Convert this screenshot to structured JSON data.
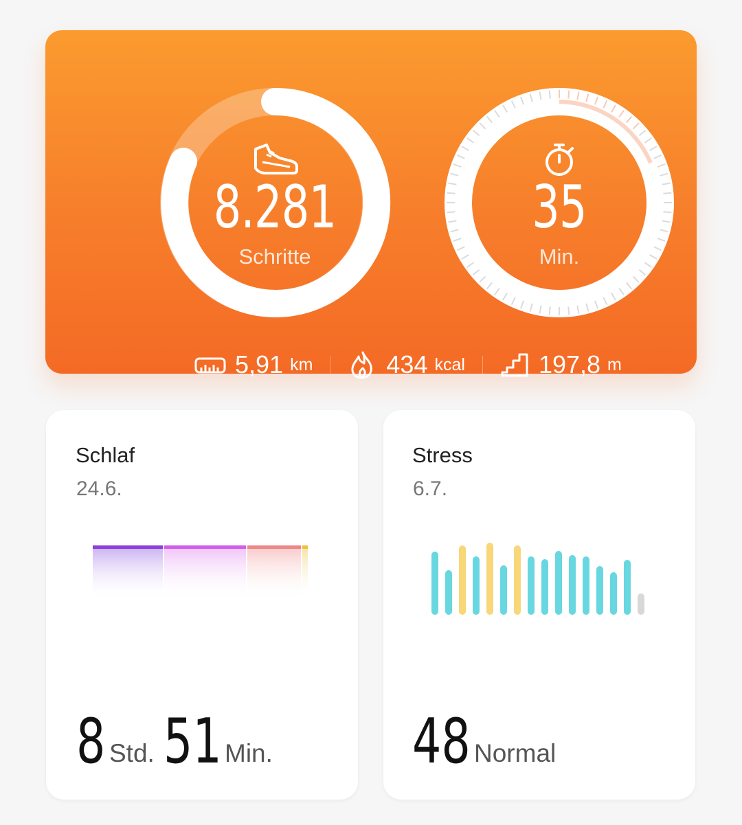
{
  "activity": {
    "steps": {
      "value": "8.281",
      "unit": "Schritte",
      "icon": "shoe-icon"
    },
    "active_minutes": {
      "value": "35",
      "unit": "Min.",
      "icon": "stopwatch-icon"
    },
    "distance": {
      "value": "5,91",
      "unit": "km",
      "icon": "ruler-icon"
    },
    "calories": {
      "value": "434",
      "unit": "kcal",
      "icon": "flame-icon"
    },
    "climb": {
      "value": "197,8",
      "unit": "m",
      "icon": "stairs-icon"
    },
    "colors": {
      "gradient_top": "#fb9b2e",
      "gradient_bottom": "#f46a25",
      "ring": "#ffffff"
    }
  },
  "sleep": {
    "title": "Schlaf",
    "date": "24.6.",
    "hours": "8",
    "hours_unit": "Std.",
    "minutes": "51",
    "minutes_unit": "Min.",
    "colors": {
      "deep": "#8d3fd7",
      "light": "#cf5fe8",
      "rem": "#ec8887",
      "awake": "#edc23b"
    }
  },
  "stress": {
    "title": "Stress",
    "date": "6.7.",
    "value": "48",
    "level": "Normal",
    "colors": {
      "relaxed": "#69d7e0",
      "normal": "#f8d779",
      "empty": "#d8d8d8"
    }
  }
}
